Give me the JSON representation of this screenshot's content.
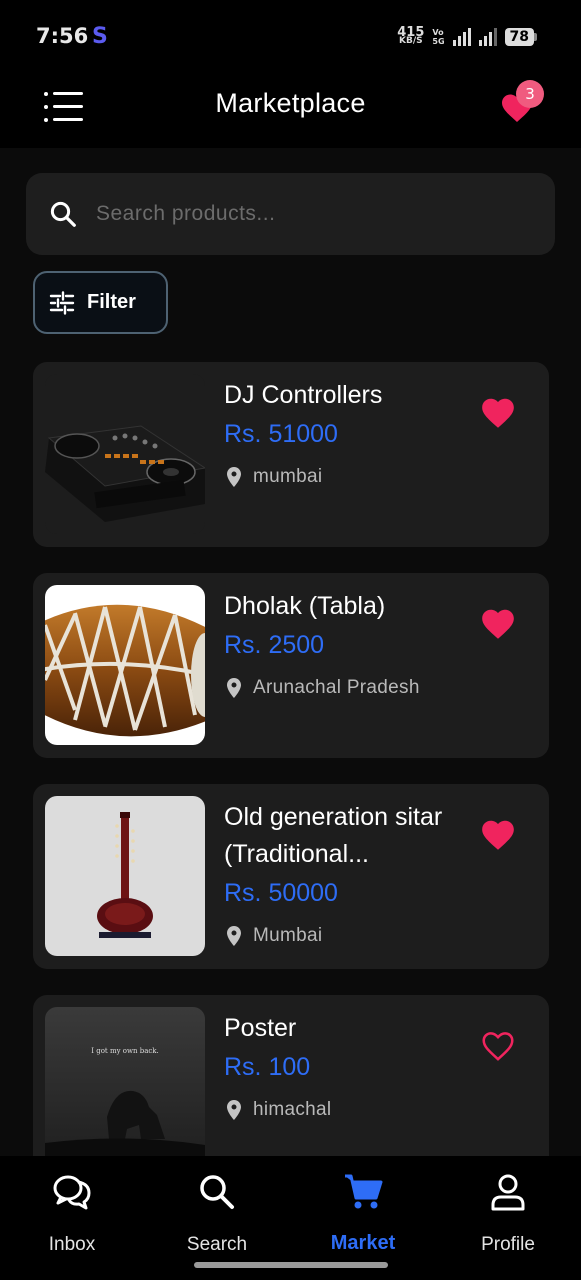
{
  "status_bar": {
    "time": "7:56",
    "app_icon_letter": "S",
    "net_speed_value": "415",
    "net_speed_unit": "KB/S",
    "network_label_1": "Vo",
    "network_label_2": "5G",
    "battery_level": "78"
  },
  "app_bar": {
    "title": "Marketplace",
    "menu_icon": "menu-icon",
    "favorites_icon": "heart-icon",
    "favorites_count": "3"
  },
  "search": {
    "placeholder": "Search products...",
    "value": "",
    "icon": "search-icon"
  },
  "filter": {
    "label": "Filter",
    "icon": "sliders-icon"
  },
  "products": [
    {
      "title": "DJ Controllers",
      "price": "Rs. 51000",
      "location": "mumbai",
      "favorited": true,
      "image": "dj-controller-image"
    },
    {
      "title": "Dholak (Tabla)",
      "price": "Rs. 2500",
      "location": "Arunachal Pradesh",
      "favorited": true,
      "image": "dholak-image"
    },
    {
      "title": "Old generation sitar (Traditional...",
      "price": "Rs. 50000",
      "location": "Mumbai",
      "favorited": true,
      "image": "sitar-image"
    },
    {
      "title": "Poster",
      "price": "Rs. 100",
      "location": "himachal",
      "favorited": false,
      "image": "poster-image",
      "image_caption": "I got my own back."
    }
  ],
  "bottom_nav": {
    "items": [
      {
        "label": "Inbox",
        "icon": "chat-icon",
        "active": false
      },
      {
        "label": "Search",
        "icon": "search-icon",
        "active": false
      },
      {
        "label": "Market",
        "icon": "cart-icon",
        "active": true
      },
      {
        "label": "Profile",
        "icon": "person-icon",
        "active": false
      }
    ]
  },
  "colors": {
    "accent_blue": "#2e6df6",
    "heart_pink": "#f0245e",
    "badge_pink": "#f05b7f",
    "card_bg": "#1d1d1d",
    "background": "#0b0b0b"
  }
}
